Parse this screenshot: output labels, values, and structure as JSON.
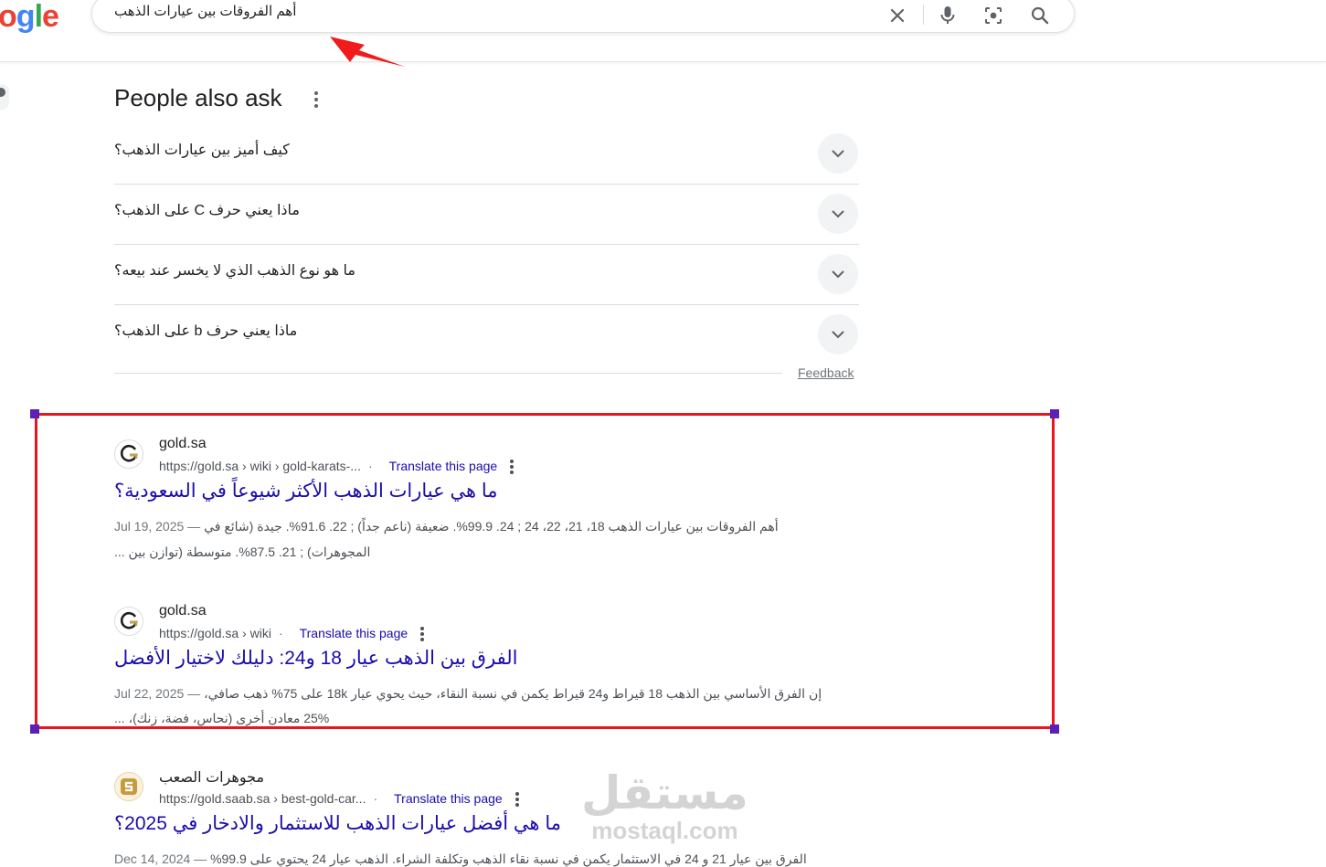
{
  "logo": {
    "text": "ogle",
    "letters": [
      {
        "char": "o",
        "color": "#ea4335"
      },
      {
        "char": "g",
        "color": "#4285f4"
      },
      {
        "char": "l",
        "color": "#34a853"
      },
      {
        "char": "e",
        "color": "#ea4335"
      }
    ]
  },
  "search": {
    "query": "أهم الفروقات بين عيارات الذهب"
  },
  "icons": {
    "clear": "close-icon",
    "voice": "microphone-icon",
    "lens": "camera-lens-icon",
    "search": "search-icon"
  },
  "paa": {
    "title": "People also ask",
    "questions": [
      "كيف أميز بين عيارات الذهب؟",
      "ماذا يعني حرف C على الذهب؟",
      "ما هو نوع الذهب الذي لا يخسر عند بيعه؟",
      "ماذا يعني حرف b على الذهب؟"
    ],
    "feedback": "Feedback"
  },
  "results": [
    {
      "site": "gold.sa",
      "url": "https://gold.sa › wiki › gold-karats-...",
      "translate": "Translate this page",
      "title": "ما هي عيارات الذهب الأكثر شيوعاً في السعودية؟",
      "date": "Jul 19, 2025 —",
      "snippet1": "أهم الفروقات بين عيارات الذهب 18، 21، 22، 24 ; 24. 99.9%. ضعيفة (ناعم جداً) ; 22. 91.6%. جيدة (شائع في",
      "snippet2": "المجوهرات) ; 21. 87.5%. متوسطة (توازن بين ..."
    },
    {
      "site": "gold.sa",
      "url": "https://gold.sa › wiki",
      "translate": "Translate this page",
      "title": "الفرق بين الذهب عيار 18 و24: دليلك لاختيار الأفضل",
      "date": "Jul 22, 2025 —",
      "snippet1": "إن الفرق الأساسي بين الذهب 18 قيراط و24 قيراط يكمن في نسبة النقاء، حيث يحوي عيار 18k على 75% ذهب صافي،",
      "snippet2": "25% معادن أخرى (نحاس، فضة، زنك)، ..."
    },
    {
      "site": "مجوهرات الصعب",
      "url": "https://gold.saab.sa › best-gold-car...",
      "translate": "Translate this page",
      "title": "ما هي أفضل عيارات الذهب للاستثمار والادخار في 2025؟",
      "date": "Dec 14, 2024 —",
      "snippet1": "الفرق بين عيار 21 و 24 في الاستثمار يكمن في نسبة نقاء الذهب وتكلفة الشراء. الذهب عيار 24 يحتوي على 99.9%"
    }
  ],
  "watermark": {
    "ar": "مستقل",
    "en": "mostaql.com"
  },
  "colors": {
    "highlight": "#e8141e",
    "link": "#1a0dab",
    "handle": "#5b21b6"
  }
}
